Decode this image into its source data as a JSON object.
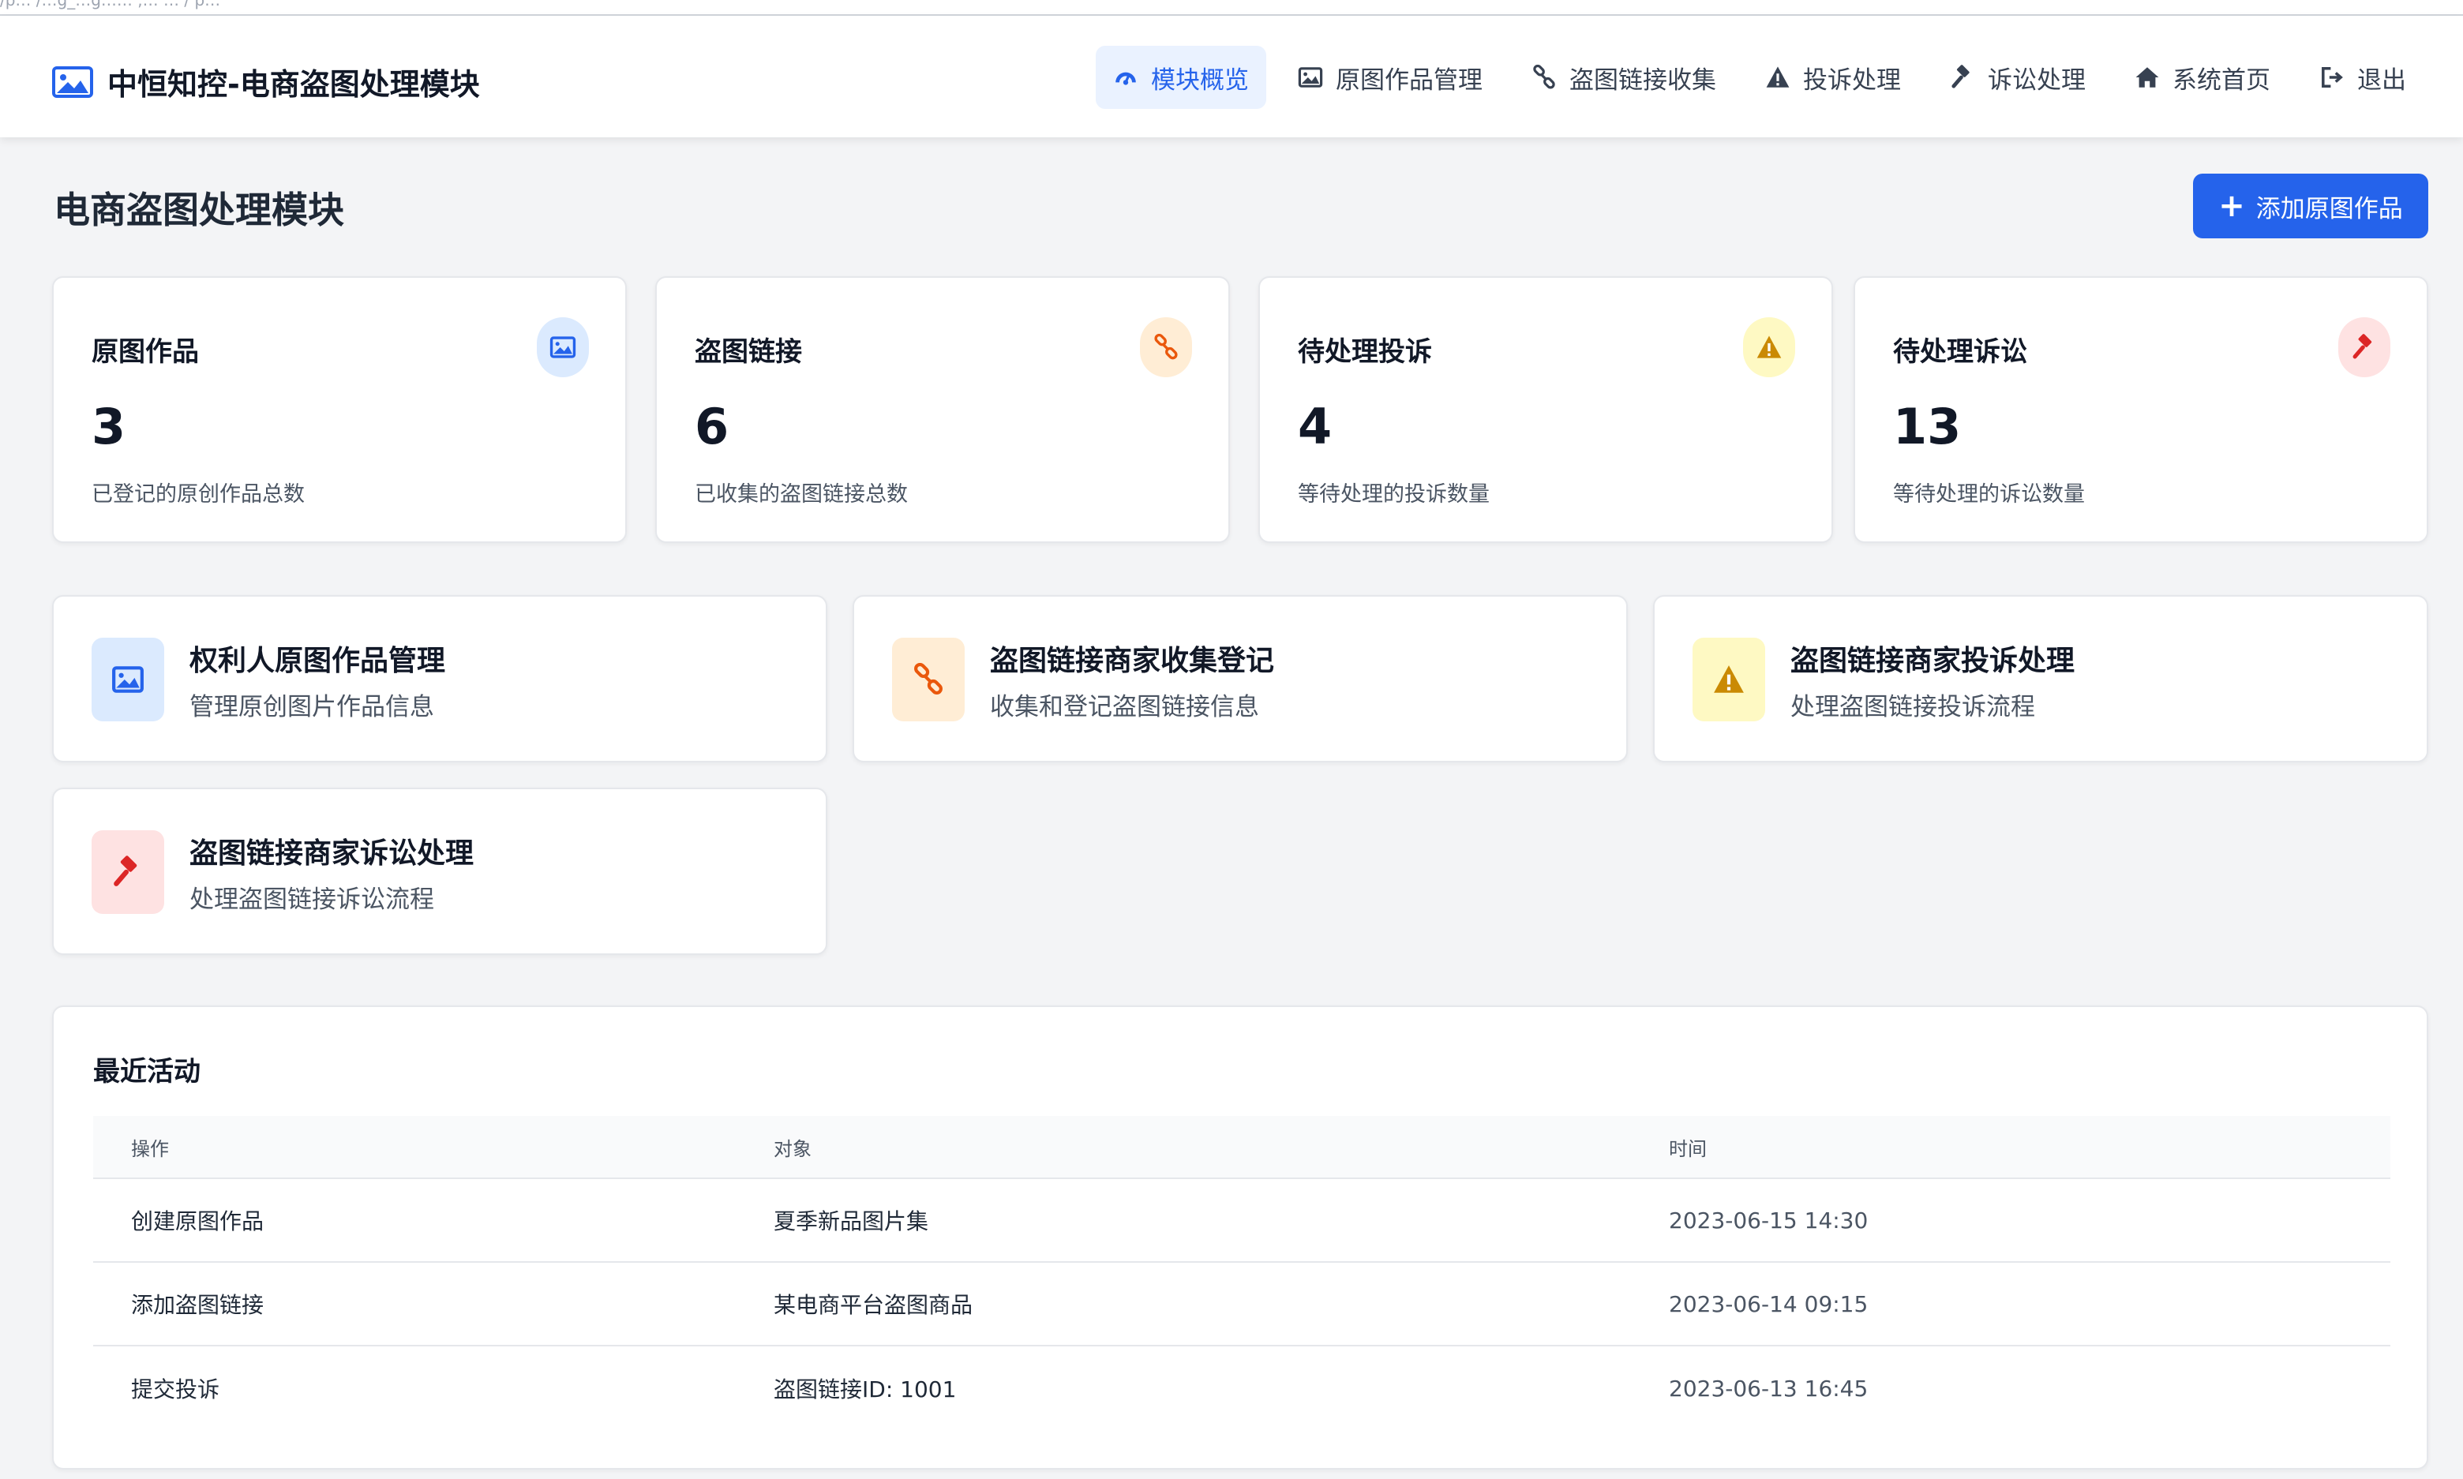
{
  "address_bar": {
    "text": "/p… /…g_…g…… ,… … / p…"
  },
  "brand": {
    "title": "中恒知控-电商盗图处理模块",
    "icon": "image-icon"
  },
  "nav": {
    "items": [
      {
        "label": "模块概览",
        "icon": "dashboard-icon",
        "active": true
      },
      {
        "label": "原图作品管理",
        "icon": "image-icon"
      },
      {
        "label": "盗图链接收集",
        "icon": "link-icon"
      },
      {
        "label": "投诉处理",
        "icon": "warning-icon"
      },
      {
        "label": "诉讼处理",
        "icon": "gavel-icon"
      },
      {
        "label": "系统首页",
        "icon": "home-icon"
      },
      {
        "label": "退出",
        "icon": "sign-out-icon"
      }
    ]
  },
  "page": {
    "title": "电商盗图处理模块",
    "add_button": "添加原图作品"
  },
  "stats": [
    {
      "title": "原图作品",
      "value": "3",
      "desc": "已登记的原创作品总数",
      "icon": "image-icon",
      "color": "#2563eb",
      "bg": "#dbeafe"
    },
    {
      "title": "盗图链接",
      "value": "6",
      "desc": "已收集的盗图链接总数",
      "icon": "link-icon",
      "color": "#ea580c",
      "bg": "#ffedd5"
    },
    {
      "title": "待处理投诉",
      "value": "4",
      "desc": "等待处理的投诉数量",
      "icon": "warning-icon",
      "color": "#ca8a04",
      "bg": "#fef9c3"
    },
    {
      "title": "待处理诉讼",
      "value": "13",
      "desc": "等待处理的诉讼数量",
      "icon": "gavel-icon",
      "color": "#dc2626",
      "bg": "#fee2e2"
    }
  ],
  "modules": [
    {
      "title": "权利人原图作品管理",
      "desc": "管理原创图片作品信息",
      "icon": "image-icon",
      "color": "#2563eb",
      "bg": "#dbeafe"
    },
    {
      "title": "盗图链接商家收集登记",
      "desc": "收集和登记盗图链接信息",
      "icon": "link-icon",
      "color": "#ea580c",
      "bg": "#ffedd5"
    },
    {
      "title": "盗图链接商家投诉处理",
      "desc": "处理盗图链接投诉流程",
      "icon": "warning-icon",
      "color": "#ca8a04",
      "bg": "#fef9c3"
    },
    {
      "title": "盗图链接商家诉讼处理",
      "desc": "处理盗图链接诉讼流程",
      "icon": "gavel-icon",
      "color": "#dc2626",
      "bg": "#fee2e2"
    }
  ],
  "activity": {
    "title": "最近活动",
    "columns": [
      "操作",
      "对象",
      "时间"
    ],
    "rows": [
      [
        "创建原图作品",
        "夏季新品图片集",
        "2023-06-15 14:30"
      ],
      [
        "添加盗图链接",
        "某电商平台盗图商品",
        "2023-06-14 09:15"
      ],
      [
        "提交投诉",
        "盗图链接ID: 1001",
        "2023-06-13 16:45"
      ]
    ]
  }
}
